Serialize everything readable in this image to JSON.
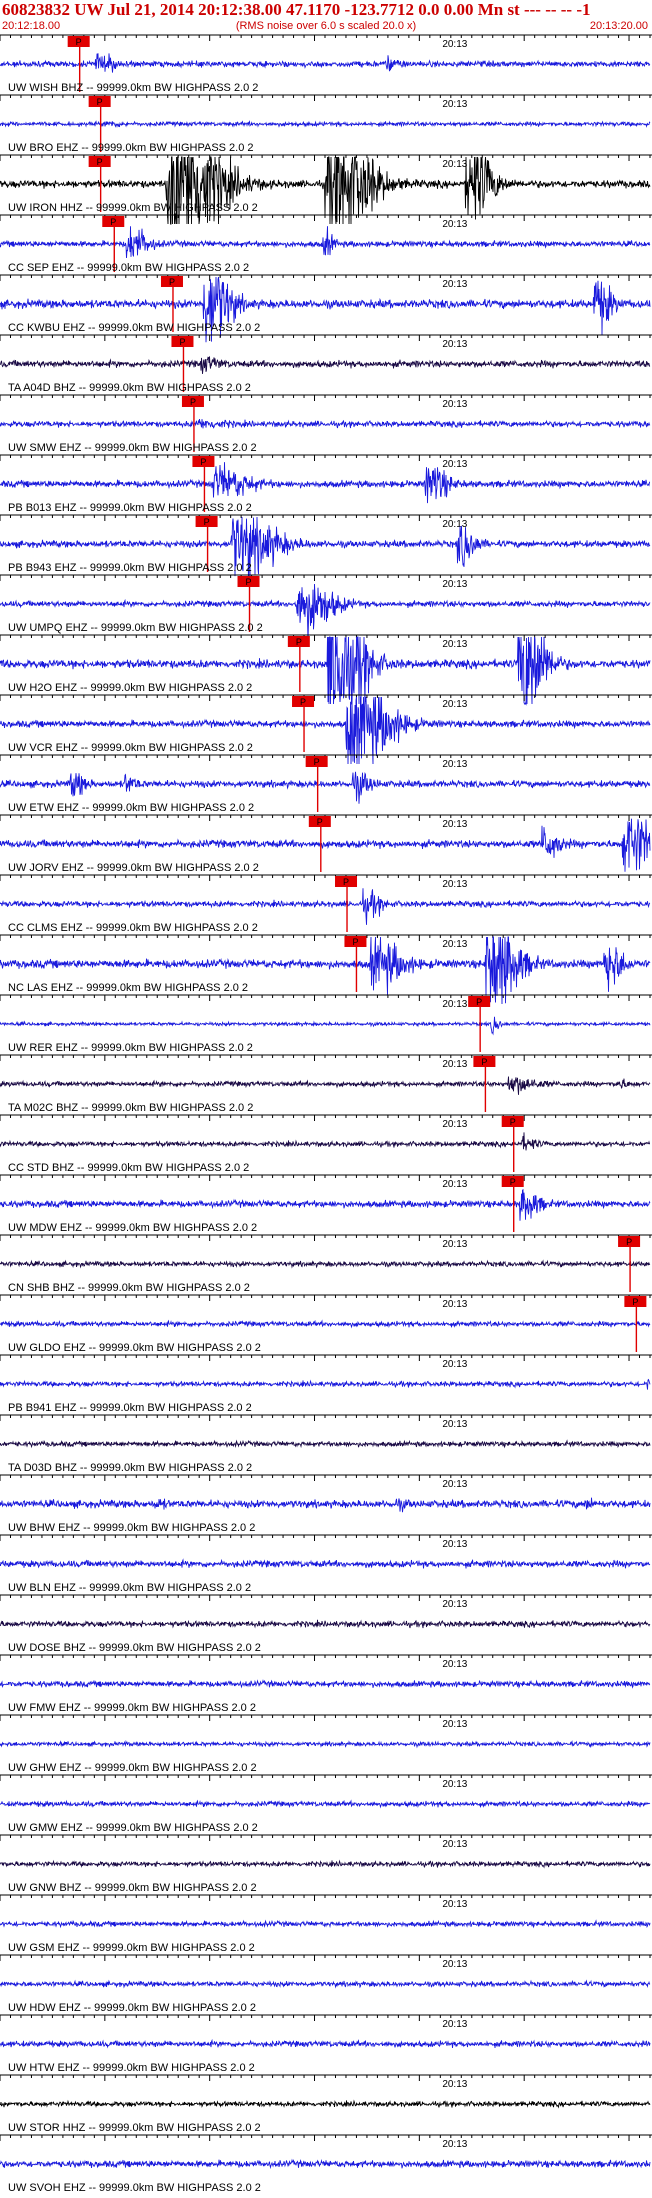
{
  "header": {
    "title": "60823832 UW Jul 21, 2014 20:12:38.00   47.1170 -123.7712  0.0 0.00 Mn st --- -- --  -1",
    "start_time": "20:12:18.00",
    "note": "(RMS noise over 6.0 s scaled 20.0 x)",
    "end_time": "20:13:20.00"
  },
  "chart_data": {
    "type": "line",
    "title": "60823832 UW Jul 21, 2014 20:12:38.00   47.1170 -123.7712  0.0 0.00 Mn st --- -- --  -1",
    "x_start": "20:12:18.00",
    "x_end": "20:13:20.00",
    "x_range_s": [
      0,
      62
    ],
    "minute_label": "20:13",
    "minute_label_s": 42,
    "pick_label": "P",
    "colors": {
      "header": "#cc0000",
      "pick": "#e00000",
      "trace_blue": "#1a1adc",
      "trace_dark": "#1a0a45",
      "trace_black": "#000000"
    },
    "traces": [
      {
        "label": "UW WISH BHZ -- 99999.0km BW  HIGHPASS  2.0  2",
        "color": "blue",
        "amp": 0.35,
        "pick_s": 7.6,
        "events": [
          [
            9.5,
            1.2,
            0.9
          ],
          [
            37,
            0.8,
            0.6
          ]
        ]
      },
      {
        "label": "UW BRO EHZ -- 99999.0km BW  HIGHPASS  2.0  2",
        "color": "blue",
        "amp": 0.25,
        "pick_s": 9.6,
        "events": [
          [
            10.3,
            0.8,
            0.3
          ]
        ]
      },
      {
        "label": "UW IRON HHZ -- 99999.0km BW  HIGHPASS  2.0  2",
        "color": "black",
        "amp": 0.45,
        "pick_s": 9.6,
        "events": [
          [
            17,
            3.0,
            9.0
          ],
          [
            32,
            2.5,
            8.0
          ],
          [
            45,
            1.5,
            5.0
          ]
        ]
      },
      {
        "label": "CC SEP EHZ -- 99999.0km BW  HIGHPASS  2.0  2",
        "color": "blue",
        "amp": 0.35,
        "pick_s": 10.9,
        "events": [
          [
            12.5,
            1.2,
            2.0
          ],
          [
            31,
            0.6,
            1.5
          ]
        ]
      },
      {
        "label": "CC KWBU EHZ -- 99999.0km BW  HIGHPASS  2.0  2",
        "color": "blue",
        "amp": 0.5,
        "pick_s": 16.5,
        "events": [
          [
            20,
            1.5,
            5.0
          ],
          [
            57,
            1.0,
            3.0
          ]
        ]
      },
      {
        "label": "TA A04D BHZ -- 99999.0km BW  HIGHPASS  2.0  2",
        "color": "dark",
        "amp": 0.4,
        "pick_s": 17.5,
        "events": [
          [
            19.5,
            1.0,
            0.8
          ]
        ]
      },
      {
        "label": "UW SMW EHZ -- 99999.0km BW  HIGHPASS  2.0  2",
        "color": "blue",
        "amp": 0.35,
        "pick_s": 18.5,
        "events": [
          [
            19.3,
            1.5,
            0.4
          ]
        ]
      },
      {
        "label": "PB B013 EHZ -- 99999.0km BW  HIGHPASS  2.0  2",
        "color": "blue",
        "amp": 0.4,
        "pick_s": 19.5,
        "events": [
          [
            21,
            2.0,
            2.0
          ],
          [
            41,
            1.2,
            2.5
          ]
        ]
      },
      {
        "label": "PB B943 EHZ -- 99999.0km BW  HIGHPASS  2.0  2",
        "color": "blue",
        "amp": 0.4,
        "pick_s": 19.8,
        "events": [
          [
            23,
            2.5,
            4.0
          ],
          [
            44,
            1.0,
            2.5
          ]
        ]
      },
      {
        "label": "UW UMPQ EHZ -- 99999.0km BW  HIGHPASS  2.0  2",
        "color": "blue",
        "amp": 0.35,
        "pick_s": 23.8,
        "events": [
          [
            29,
            2.0,
            3.5
          ]
        ]
      },
      {
        "label": "UW H2O EHZ -- 99999.0km BW  HIGHPASS  2.0  2",
        "color": "blue",
        "amp": 0.5,
        "pick_s": 28.6,
        "events": [
          [
            32,
            2.0,
            10.0
          ],
          [
            50,
            1.5,
            8.0
          ]
        ]
      },
      {
        "label": "UW VCR EHZ -- 99999.0km BW  HIGHPASS  2.0  2",
        "color": "blue",
        "amp": 0.4,
        "pick_s": 29.0,
        "events": [
          [
            34,
            2.5,
            6.0
          ]
        ]
      },
      {
        "label": "UW ETW EHZ -- 99999.0km BW  HIGHPASS  2.0  2",
        "color": "blue",
        "amp": 0.4,
        "pick_s": 30.3,
        "events": [
          [
            7,
            0.8,
            1.5
          ],
          [
            12,
            0.7,
            1.0
          ],
          [
            34,
            1.0,
            1.5
          ]
        ]
      },
      {
        "label": "UW JORV EHZ -- 99999.0km BW  HIGHPASS  2.0  2",
        "color": "blue",
        "amp": 0.45,
        "pick_s": 30.6,
        "events": [
          [
            60,
            1.6,
            4.0
          ],
          [
            52,
            1.0,
            2.0
          ]
        ]
      },
      {
        "label": "CC CLMS EHZ -- 99999.0km BW  HIGHPASS  2.0  2",
        "color": "blue",
        "amp": 0.35,
        "pick_s": 33.1,
        "events": [
          [
            35,
            1.0,
            1.5
          ]
        ]
      },
      {
        "label": "NC LAS EHZ -- 99999.0km BW  HIGHPASS  2.0  2",
        "color": "blue",
        "amp": 0.5,
        "pick_s": 34.0,
        "events": [
          [
            36,
            1.8,
            3.0
          ],
          [
            47,
            1.8,
            6.0
          ],
          [
            58,
            1.0,
            3.0
          ]
        ]
      },
      {
        "label": "UW RER EHZ -- 99999.0km BW  HIGHPASS  2.0  2",
        "color": "blue",
        "amp": 0.2,
        "pick_s": 45.8,
        "events": [
          [
            47,
            0.5,
            1.0
          ]
        ]
      },
      {
        "label": "TA M02C BHZ -- 99999.0km BW  HIGHPASS  2.0  2",
        "color": "dark",
        "amp": 0.3,
        "pick_s": 46.3,
        "events": [
          [
            49,
            1.5,
            1.0
          ],
          [
            59,
            0.6,
            0.5
          ]
        ]
      },
      {
        "label": "CC STD BHZ -- 99999.0km BW  HIGHPASS  2.0  2",
        "color": "dark",
        "amp": 0.3,
        "pick_s": 49.0,
        "events": [
          [
            50,
            0.8,
            0.8
          ]
        ]
      },
      {
        "label": "UW MDW EHZ -- 99999.0km BW  HIGHPASS  2.0  2",
        "color": "blue",
        "amp": 0.4,
        "pick_s": 49.0,
        "events": [
          [
            50,
            1.0,
            2.0
          ]
        ]
      },
      {
        "label": "CN SHB BHZ -- 99999.0km BW  HIGHPASS  2.0  2",
        "color": "dark",
        "amp": 0.3,
        "pick_s": 60.1,
        "events": []
      },
      {
        "label": "UW GLDO EHZ -- 99999.0km BW  HIGHPASS  2.0  2",
        "color": "blue",
        "amp": 0.3,
        "pick_s": 60.7,
        "events": []
      },
      {
        "label": "PB B941 EHZ -- 99999.0km BW  HIGHPASS  2.0  2",
        "color": "blue",
        "amp": 0.3,
        "pick_s": null,
        "events": [
          [
            62,
            0.8,
            0.8
          ]
        ]
      },
      {
        "label": "TA D03D BHZ -- 99999.0km BW  HIGHPASS  2.0  2",
        "color": "dark",
        "amp": 0.3,
        "pick_s": null,
        "events": []
      },
      {
        "label": "UW BHW EHZ -- 99999.0km BW  HIGHPASS  2.0  2",
        "color": "blue",
        "amp": 0.45,
        "pick_s": null,
        "events": [
          [
            15,
            0.6,
            0.4
          ],
          [
            38,
            0.6,
            0.4
          ],
          [
            56,
            0.5,
            0.4
          ]
        ]
      },
      {
        "label": "UW BLN EHZ -- 99999.0km BW  HIGHPASS  2.0  2",
        "color": "blue",
        "amp": 0.4,
        "pick_s": null,
        "events": []
      },
      {
        "label": "UW DOSE BHZ -- 99999.0km BW  HIGHPASS  2.0  2",
        "color": "dark",
        "amp": 0.35,
        "pick_s": null,
        "events": []
      },
      {
        "label": "UW FMW EHZ -- 99999.0km BW  HIGHPASS  2.0  2",
        "color": "blue",
        "amp": 0.35,
        "pick_s": null,
        "events": []
      },
      {
        "label": "UW GHW EHZ -- 99999.0km BW  HIGHPASS  2.0  2",
        "color": "blue",
        "amp": 0.25,
        "pick_s": null,
        "events": []
      },
      {
        "label": "UW GMW EHZ -- 99999.0km BW  HIGHPASS  2.0  2",
        "color": "blue",
        "amp": 0.3,
        "pick_s": null,
        "events": []
      },
      {
        "label": "UW GNW BHZ -- 99999.0km BW  HIGHPASS  2.0  2",
        "color": "dark",
        "amp": 0.3,
        "pick_s": null,
        "events": []
      },
      {
        "label": "UW GSM EHZ -- 99999.0km BW  HIGHPASS  2.0  2",
        "color": "blue",
        "amp": 0.3,
        "pick_s": null,
        "events": []
      },
      {
        "label": "UW HDW EHZ -- 99999.0km BW  HIGHPASS  2.0  2",
        "color": "blue",
        "amp": 0.3,
        "pick_s": null,
        "events": []
      },
      {
        "label": "UW HTW EHZ -- 99999.0km BW  HIGHPASS  2.0  2",
        "color": "blue",
        "amp": 0.35,
        "pick_s": null,
        "events": []
      },
      {
        "label": "UW STOR HHZ -- 99999.0km BW  HIGHPASS  2.0  2",
        "color": "black",
        "amp": 0.3,
        "pick_s": null,
        "events": []
      },
      {
        "label": "UW SVOH EHZ -- 99999.0km BW  HIGHPASS  2.0  2",
        "color": "blue",
        "amp": 0.4,
        "pick_s": null,
        "events": []
      }
    ]
  }
}
